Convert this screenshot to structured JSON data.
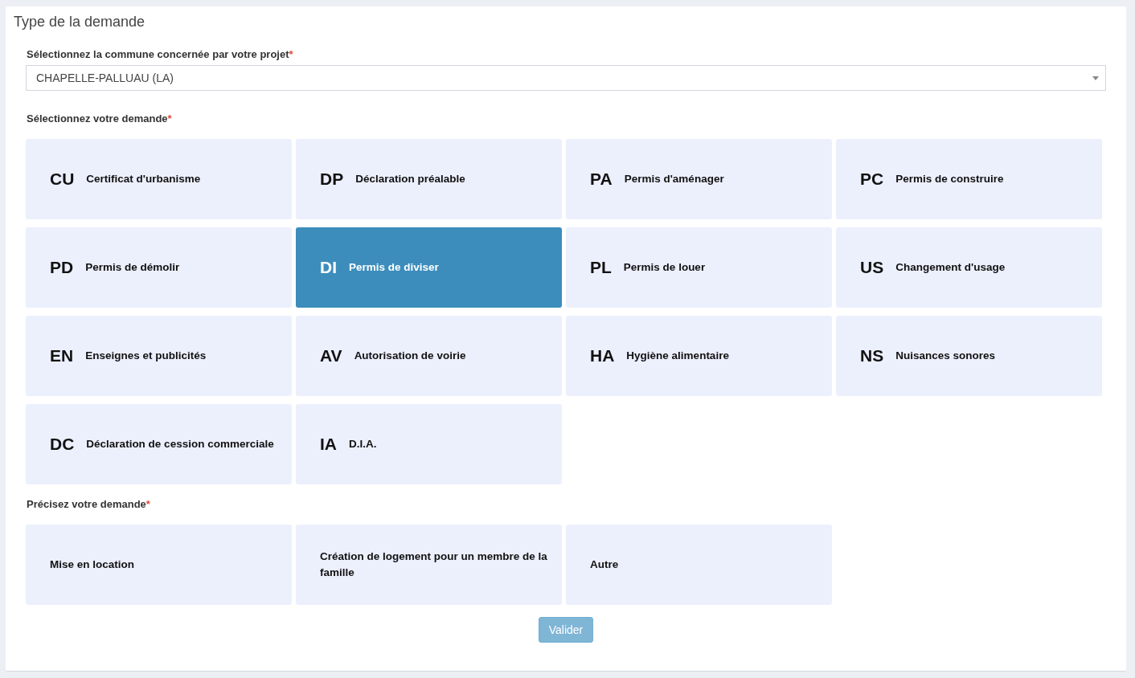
{
  "panel": {
    "title": "Type de la demande"
  },
  "commune": {
    "label": "Sélectionnez la commune concernée par votre projet",
    "required_mark": "*",
    "value": "CHAPELLE-PALLUAU (LA)"
  },
  "demande": {
    "label": "Sélectionnez votre demande",
    "required_mark": "*",
    "options": [
      {
        "code": "CU",
        "label": "Certificat d'urbanisme",
        "selected": false
      },
      {
        "code": "DP",
        "label": "Déclaration préalable",
        "selected": false
      },
      {
        "code": "PA",
        "label": "Permis d'aménager",
        "selected": false
      },
      {
        "code": "PC",
        "label": "Permis de construire",
        "selected": false
      },
      {
        "code": "PD",
        "label": "Permis de démolir",
        "selected": false
      },
      {
        "code": "DI",
        "label": "Permis de diviser",
        "selected": true
      },
      {
        "code": "PL",
        "label": "Permis de louer",
        "selected": false
      },
      {
        "code": "US",
        "label": "Changement d'usage",
        "selected": false
      },
      {
        "code": "EN",
        "label": "Enseignes et publicités",
        "selected": false
      },
      {
        "code": "AV",
        "label": "Autorisation de voirie",
        "selected": false
      },
      {
        "code": "HA",
        "label": "Hygiène alimentaire",
        "selected": false
      },
      {
        "code": "NS",
        "label": "Nuisances sonores",
        "selected": false
      },
      {
        "code": "DC",
        "label": "Déclaration de cession commerciale",
        "selected": false
      },
      {
        "code": "IA",
        "label": "D.I.A.",
        "selected": false
      }
    ]
  },
  "precision": {
    "label": "Précisez votre demande",
    "required_mark": "*",
    "options": [
      {
        "label": "Mise en location",
        "selected": false
      },
      {
        "label": "Création de logement pour un membre de la famille",
        "selected": false
      },
      {
        "label": "Autre",
        "selected": false
      }
    ]
  },
  "submit": {
    "label": "Valider",
    "disabled": true
  }
}
